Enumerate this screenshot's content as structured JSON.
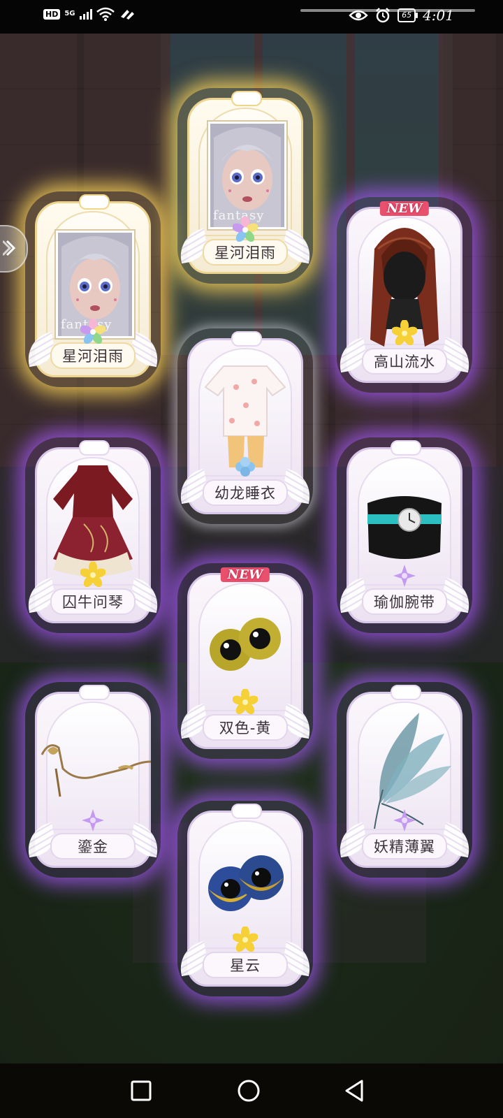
{
  "status_bar": {
    "hd_label": "HD",
    "network_label": "5G",
    "clock": "4:01",
    "battery_level": "65"
  },
  "cards": [
    {
      "id": "c1",
      "name": "星河泪雨",
      "rarity": "gold",
      "type": "portrait",
      "brand_text": "fantasy",
      "new": false,
      "flower": "multicolor"
    },
    {
      "id": "c2",
      "name": "星河泪雨",
      "rarity": "gold",
      "type": "portrait",
      "brand_text": "fantasy",
      "new": false,
      "flower": "multicolor"
    },
    {
      "id": "c3",
      "name": "高山流水",
      "rarity": "purple",
      "type": "hair",
      "new": true,
      "new_label": "NEW",
      "flower": "yellow"
    },
    {
      "id": "c4",
      "name": "幼龙睡衣",
      "rarity": "purple",
      "type": "pajamas",
      "new": false,
      "flower": "blue"
    },
    {
      "id": "c5",
      "name": "囚牛问琴",
      "rarity": "purple",
      "type": "dress",
      "new": false,
      "flower": "yellow"
    },
    {
      "id": "c6",
      "name": "瑜伽腕带",
      "rarity": "purple",
      "type": "wristband",
      "new": false,
      "flower": "purple"
    },
    {
      "id": "c7",
      "name": "双色-黄",
      "rarity": "purple",
      "type": "eyes-yellow",
      "new": true,
      "new_label": "NEW",
      "flower": "yellow"
    },
    {
      "id": "c8",
      "name": "鎏金",
      "rarity": "purple",
      "type": "glasses",
      "new": false,
      "flower": "purple"
    },
    {
      "id": "c9",
      "name": "妖精薄翼",
      "rarity": "purple",
      "type": "wings",
      "new": false,
      "flower": "purple"
    },
    {
      "id": "c10",
      "name": "星云",
      "rarity": "purple",
      "type": "eyes-blue",
      "new": false,
      "flower": "yellow"
    }
  ],
  "colors": {
    "glow_purple": "#aa5aff",
    "glow_gold": "#ffd75a",
    "new_badge": "#e8506e"
  },
  "icons": {
    "side_arrow": "double-chevron-left-icon",
    "nav_recent": "square-icon",
    "nav_home": "circle-icon",
    "nav_back": "triangle-back-icon"
  }
}
